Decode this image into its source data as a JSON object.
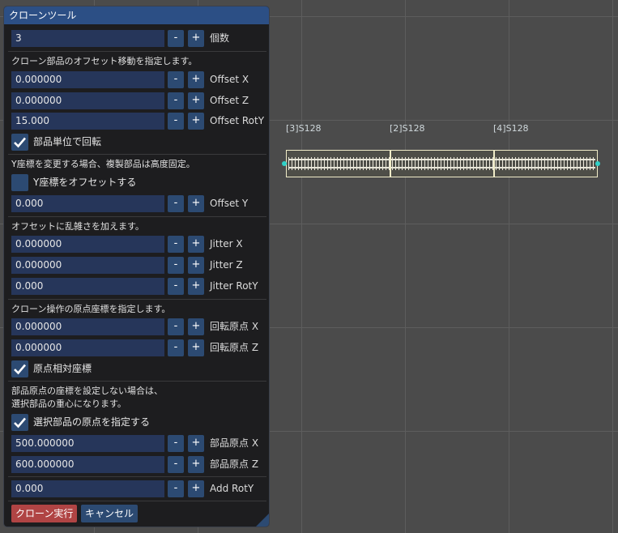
{
  "viewport": {
    "track_labels": [
      "[3]S128",
      "[2]S128",
      "[4]S128"
    ]
  },
  "panel": {
    "title": "クローンツール",
    "count": {
      "value": "3",
      "label": "個数"
    },
    "offset_desc": "クローン部品のオフセット移動を指定します。",
    "offset_x": {
      "value": "0.000000",
      "label": "Offset X"
    },
    "offset_z": {
      "value": "0.000000",
      "label": "Offset Z"
    },
    "offset_roty": {
      "value": "15.000",
      "label": "Offset RotY"
    },
    "per_part_rotate": {
      "label": "部品単位で回転",
      "checked": true
    },
    "y_desc": "Y座標を変更する場合、複製部品は高度固定。",
    "y_offset_check": {
      "label": "Y座標をオフセットする",
      "checked": false
    },
    "offset_y": {
      "value": "0.000",
      "label": "Offset Y"
    },
    "jitter_desc": "オフセットに乱雑さを加えます。",
    "jitter_x": {
      "value": "0.000000",
      "label": "Jitter X"
    },
    "jitter_z": {
      "value": "0.000000",
      "label": "Jitter Z"
    },
    "jitter_roty": {
      "value": "0.000",
      "label": "Jitter RotY"
    },
    "origin_desc": "クローン操作の原点座標を指定します。",
    "rot_origin_x": {
      "value": "0.000000",
      "label": "回転原点 X"
    },
    "rot_origin_z": {
      "value": "0.000000",
      "label": "回転原点 Z"
    },
    "origin_relative": {
      "label": "原点相対座標",
      "checked": true
    },
    "part_origin_desc_1": "部品原点の座標を設定しない場合は、",
    "part_origin_desc_2": "選択部品の重心になります。",
    "specify_origin": {
      "label": "選択部品の原点を指定する",
      "checked": true
    },
    "part_origin_x": {
      "value": "500.000000",
      "label": "部品原点 X"
    },
    "part_origin_z": {
      "value": "600.000000",
      "label": "部品原点 Z"
    },
    "add_roty": {
      "value": "0.000",
      "label": "Add RotY"
    },
    "minus_label": "-",
    "plus_label": "+",
    "run_button": "クローン実行",
    "cancel_button": "キャンセル"
  },
  "colors": {
    "accent": "#2c4f85",
    "field_bg": "#26365a",
    "run_button": "#b04444",
    "cancel_button": "#2c4a72"
  }
}
